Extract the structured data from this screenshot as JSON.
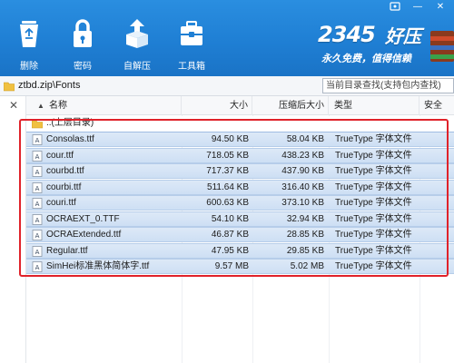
{
  "window_controls": {
    "user_icon": "user-icon",
    "minimize": "—",
    "close": "✕"
  },
  "toolbar": {
    "buttons": [
      {
        "label": "删除",
        "icon": "recycle-bin-icon"
      },
      {
        "label": "密码",
        "icon": "lock-icon"
      },
      {
        "label": "自解压",
        "icon": "box-upload-icon"
      },
      {
        "label": "工具箱",
        "icon": "toolbox-icon"
      }
    ],
    "brand_number": "2345",
    "brand_name": "好压",
    "brand_slogan": "永久免费，值得信赖"
  },
  "address": {
    "path": "ztbd.zip\\Fonts",
    "search_placeholder": "当前目录查找(支持包内查找)"
  },
  "sidebar": {
    "close_label": "✕"
  },
  "columns": {
    "name": "名称",
    "size": "大小",
    "compressed_size": "压缩后大小",
    "type": "类型",
    "security": "安全"
  },
  "parent_row": {
    "name": "..(上层目录)"
  },
  "files": [
    {
      "name": "Consolas.ttf",
      "size": "94.50 KB",
      "compressed": "58.04 KB",
      "type": "TrueType 字体文件"
    },
    {
      "name": "cour.ttf",
      "size": "718.05 KB",
      "compressed": "438.23 KB",
      "type": "TrueType 字体文件"
    },
    {
      "name": "courbd.ttf",
      "size": "717.37 KB",
      "compressed": "437.90 KB",
      "type": "TrueType 字体文件"
    },
    {
      "name": "courbi.ttf",
      "size": "511.64 KB",
      "compressed": "316.40 KB",
      "type": "TrueType 字体文件"
    },
    {
      "name": "couri.ttf",
      "size": "600.63 KB",
      "compressed": "373.10 KB",
      "type": "TrueType 字体文件"
    },
    {
      "name": "OCRAEXT_0.TTF",
      "size": "54.10 KB",
      "compressed": "32.94 KB",
      "type": "TrueType 字体文件"
    },
    {
      "name": "OCRAExtended.ttf",
      "size": "46.87 KB",
      "compressed": "28.85 KB",
      "type": "TrueType 字体文件"
    },
    {
      "name": "Regular.ttf",
      "size": "47.95 KB",
      "compressed": "29.85 KB",
      "type": "TrueType 字体文件"
    },
    {
      "name": "SimHei标准黑体简体字.ttf",
      "size": "9.57 MB",
      "compressed": "5.02 MB",
      "type": "TrueType 字体文件"
    }
  ],
  "colors": {
    "toolbar_blue": "#1f7fd4",
    "selection": "#cddff4",
    "annotation_red": "#e0222a"
  }
}
